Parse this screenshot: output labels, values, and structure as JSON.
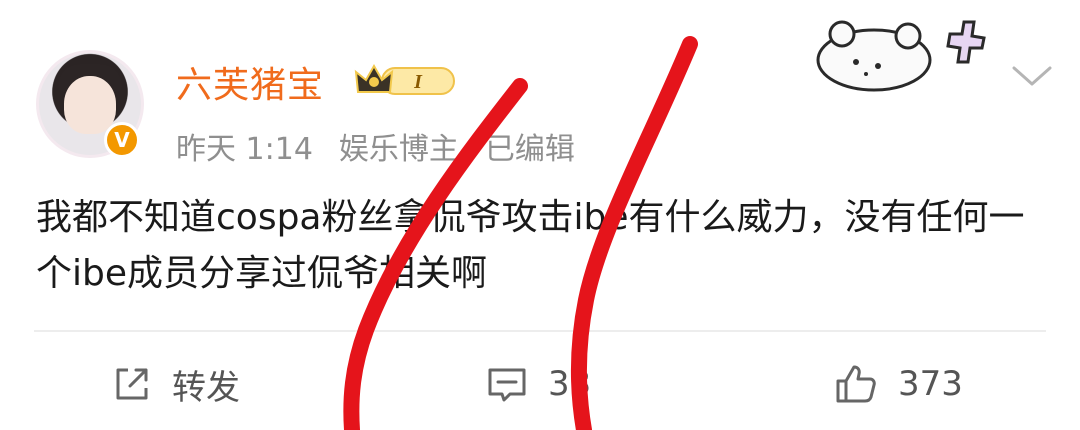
{
  "post": {
    "author": {
      "name": "六芙猪宝",
      "verified_mark": "V",
      "vip_level": "I"
    },
    "meta": {
      "time": "昨天 1:14",
      "role": "娱乐博主",
      "edited": "已编辑"
    },
    "content": "我都不知道cospa粉丝拿侃爷攻击ibe有什么威力，没有任何一个ibe成员分享过侃爷相关啊",
    "actions": {
      "repost_label": "转发",
      "comment_count": "33",
      "like_count": "373"
    }
  },
  "icons": [
    "avatar",
    "verified-icon",
    "crown-icon",
    "sticker-icon",
    "chevron-down-icon",
    "share-icon",
    "comment-icon",
    "like-icon"
  ],
  "colors": {
    "username": "#f06b1c",
    "meta_text": "#8f8f8f",
    "body_text": "#1a1a1a",
    "badge_orange": "#f39800",
    "scribble_red": "#e5141b"
  }
}
